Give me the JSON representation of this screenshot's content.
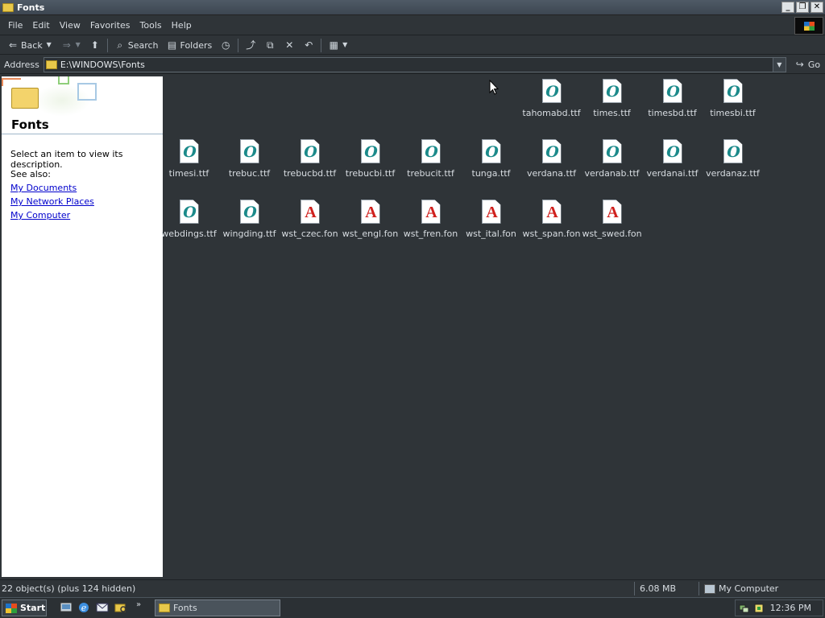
{
  "window": {
    "title": "Fonts"
  },
  "menu": [
    "File",
    "Edit",
    "View",
    "Favorites",
    "Tools",
    "Help"
  ],
  "toolbar": {
    "back": "Back",
    "search": "Search",
    "folders": "Folders"
  },
  "address": {
    "label": "Address",
    "path": "E:\\WINDOWS\\Fonts",
    "go": "Go"
  },
  "leftpane": {
    "title": "Fonts",
    "description": "Select an item to view its description.",
    "see_also": "See also:",
    "links": [
      "My Documents",
      "My Network Places",
      "My Computer"
    ]
  },
  "files": [
    {
      "name": "tahomabd.ttf",
      "type": "ttf"
    },
    {
      "name": "times.ttf",
      "type": "ttf"
    },
    {
      "name": "timesbd.ttf",
      "type": "ttf"
    },
    {
      "name": "timesbi.ttf",
      "type": "ttf"
    },
    {
      "name": "timesi.ttf",
      "type": "ttf"
    },
    {
      "name": "trebuc.ttf",
      "type": "ttf"
    },
    {
      "name": "trebucbd.ttf",
      "type": "ttf"
    },
    {
      "name": "trebucbi.ttf",
      "type": "ttf"
    },
    {
      "name": "trebucit.ttf",
      "type": "ttf"
    },
    {
      "name": "tunga.ttf",
      "type": "ttf"
    },
    {
      "name": "verdana.ttf",
      "type": "ttf"
    },
    {
      "name": "verdanab.ttf",
      "type": "ttf"
    },
    {
      "name": "verdanai.ttf",
      "type": "ttf"
    },
    {
      "name": "verdanaz.ttf",
      "type": "ttf"
    },
    {
      "name": "webdings.ttf",
      "type": "ttf"
    },
    {
      "name": "wingding.ttf",
      "type": "ttf"
    },
    {
      "name": "wst_czec.fon",
      "type": "fon"
    },
    {
      "name": "wst_engl.fon",
      "type": "fon"
    },
    {
      "name": "wst_fren.fon",
      "type": "fon"
    },
    {
      "name": "wst_ital.fon",
      "type": "fon"
    },
    {
      "name": "wst_span.fon",
      "type": "fon"
    },
    {
      "name": "wst_swed.fon",
      "type": "fon"
    }
  ],
  "status": {
    "objects": "22 object(s) (plus 124 hidden)",
    "size": "6.08 MB",
    "location": "My Computer"
  },
  "taskbar": {
    "start": "Start",
    "task": "Fonts",
    "clock": "12:36 PM"
  },
  "glyphs": {
    "ttf": "O",
    "fon": "A"
  },
  "colors": {
    "ttf_glyph": "#1b8a8a",
    "fon_glyph": "#d0201d",
    "background": "#2f3438"
  }
}
